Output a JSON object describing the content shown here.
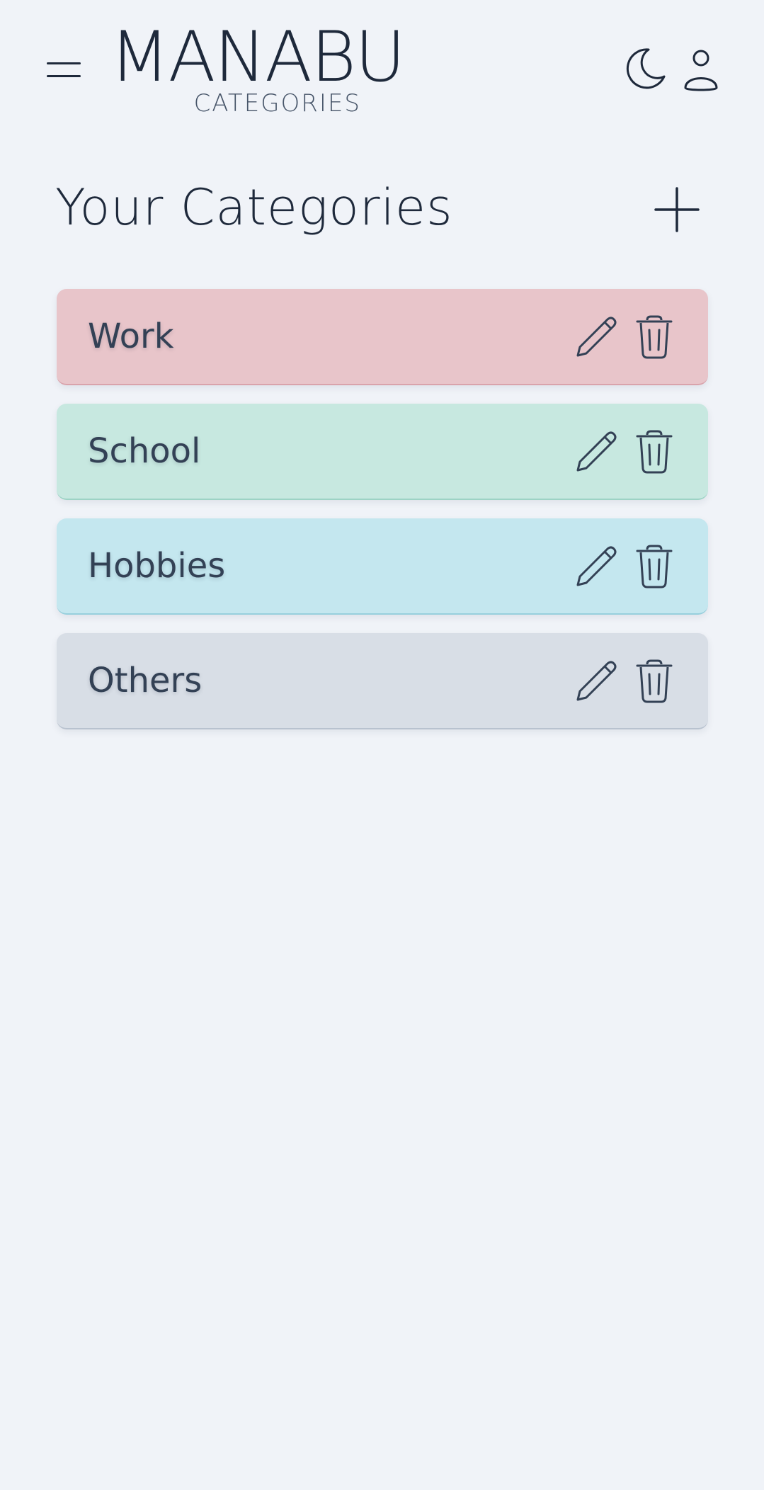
{
  "app": {
    "logo_text": "MANABU",
    "logo_subtitle": "CATEGORIES"
  },
  "header": {
    "menu_icon": "hamburger-menu-icon",
    "theme_icon": "moon-icon",
    "user_icon": "user-icon"
  },
  "page": {
    "title": "Your Categories",
    "add_icon": "plus-icon"
  },
  "categories": [
    {
      "label": "Work",
      "color": "#e8c5ca",
      "border": "#d9a3ab"
    },
    {
      "label": "School",
      "color": "#c7e8e0",
      "border": "#9dd3c5"
    },
    {
      "label": "Hobbies",
      "color": "#c4e7ef",
      "border": "#97cfdc"
    },
    {
      "label": "Others",
      "color": "#d8dee6",
      "border": "#b8c2cf"
    }
  ],
  "actions": {
    "edit_icon": "pencil-icon",
    "delete_icon": "trash-icon"
  }
}
